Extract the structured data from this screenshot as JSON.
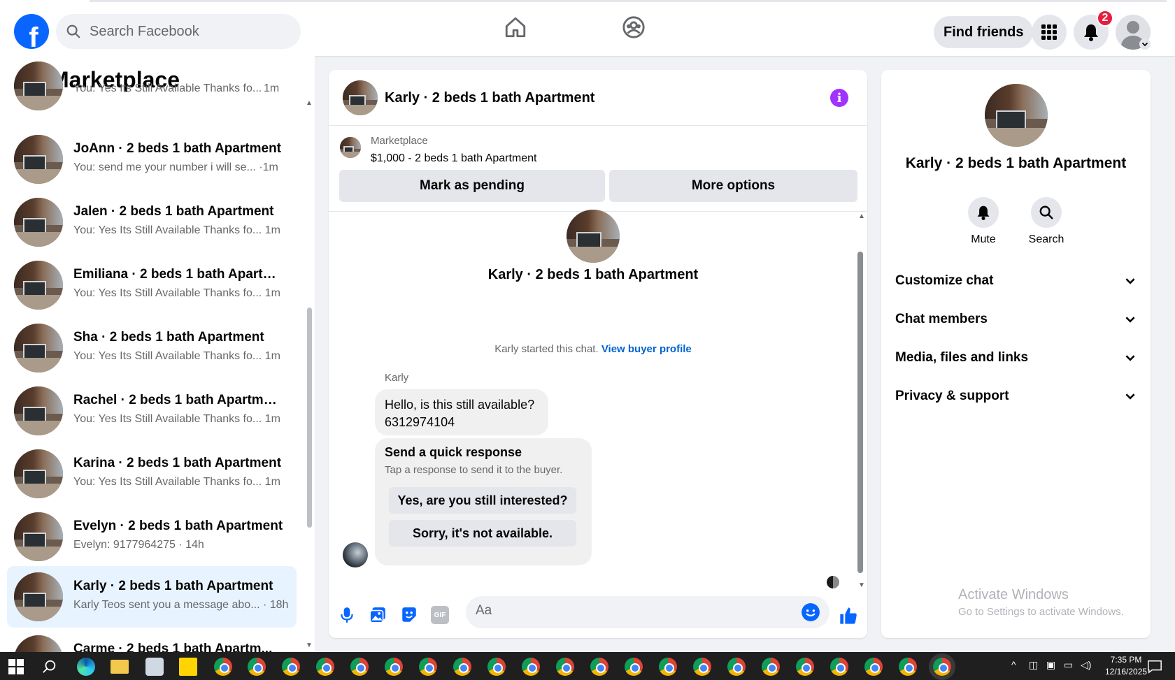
{
  "header": {
    "logo": "f",
    "search_placeholder": "Search Facebook",
    "find_friends": "Find friends",
    "notification_count": "2"
  },
  "sidebar": {
    "title": "Marketplace",
    "top_partial_snippet": "You: Yes Its Still Available Thanks fo...",
    "top_partial_time": "1m",
    "conversations": [
      {
        "name": "JoAnn · 2 beds 1 bath Apartment",
        "snippet": "You: send me your number i will se... ·1m"
      },
      {
        "name": "Jalen · 2 beds 1 bath Apartment",
        "snippet": "You: Yes Its Still Available Thanks fo...   1m"
      },
      {
        "name": "Emiliana · 2 beds 1 bath Apartme...",
        "snippet": "You: Yes Its Still Available Thanks fo...   1m"
      },
      {
        "name": "Sha · 2 beds 1 bath Apartment",
        "snippet": "You: Yes Its Still Available Thanks fo...   1m"
      },
      {
        "name": "Rachel · 2 beds 1 bath Apartment",
        "snippet": "You: Yes Its Still Available Thanks fo...   1m"
      },
      {
        "name": "Karina · 2 beds 1 bath Apartment",
        "snippet": "You: Yes Its Still Available Thanks fo...   1m"
      },
      {
        "name": "Evelyn · 2 beds 1 bath Apartment",
        "snippet": "Evelyn: 9177964275 · 14h"
      },
      {
        "name": "Karly · 2 beds 1 bath Apartment",
        "snippet": "Karly Teos sent you a message abo... · 18h"
      },
      {
        "name": "Carme · 2 beds 1 bath Apartm...",
        "snippet": ""
      }
    ]
  },
  "chat": {
    "title": "Karly · 2 beds 1 bath Apartment",
    "listing_category": "Marketplace",
    "listing_price": "$1,000 - 2 beds 1 bath Apartment",
    "mark_pending": "Mark as pending",
    "more_options": "More options",
    "intro_title": "Karly · 2 beds 1 bath Apartment",
    "started_text": "Karly started this chat.",
    "view_buyer": "View buyer profile",
    "sender": "Karly",
    "message_line1": "Hello, is this still available?",
    "message_line2": "6312974104",
    "quick_title": "Send a quick response",
    "quick_subtitle": "Tap a response to send it to the buyer.",
    "quick_option1": "Yes, are you still interested?",
    "quick_option2": "Sorry, it's not available.",
    "composer_placeholder": "Aa",
    "gif_label": "GIF"
  },
  "details": {
    "title": "Karly · 2 beds 1 bath Apartment",
    "mute": "Mute",
    "search": "Search",
    "sections": [
      "Customize chat",
      "Chat members",
      "Media, files and links",
      "Privacy & support"
    ]
  },
  "watermark": {
    "line1": "Activate Windows",
    "line2": "Go to Settings to activate Windows."
  },
  "taskbar": {
    "time": "7:35 PM",
    "date": "12/16/2025"
  },
  "colors": {
    "brand": "#0866ff",
    "link": "#0064d1",
    "badge": "#e41e3f",
    "info": "#a033ff",
    "active_row": "#e7f3ff"
  }
}
